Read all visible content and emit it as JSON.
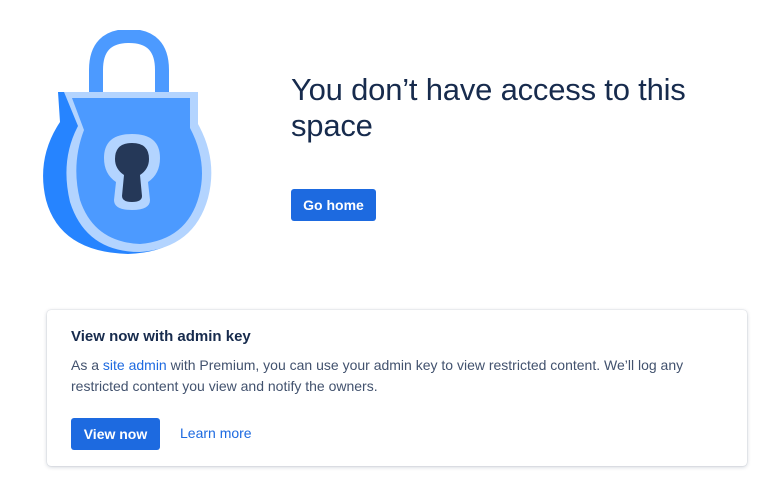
{
  "headline": "You don’t have access to this space",
  "go_home_label": "Go home",
  "admin_card": {
    "title": "View now with admin key",
    "body_prefix": "As a ",
    "site_admin_link": "site admin",
    "body_suffix": " with Premium, you can use your admin key to view restricted content. We’ll log any restricted content you view and notify the owners.",
    "view_now_label": "View now",
    "learn_more_label": "Learn more"
  },
  "icons": {
    "illustration": "padlock-icon"
  },
  "colors": {
    "primary": "#1d6ae0",
    "text": "#172b4d",
    "body_text": "#42526e",
    "lock_body": "#4c9aff",
    "lock_rim": "#2684ff",
    "lock_shackle": "#4c9aff",
    "keyhole": "#253858"
  }
}
